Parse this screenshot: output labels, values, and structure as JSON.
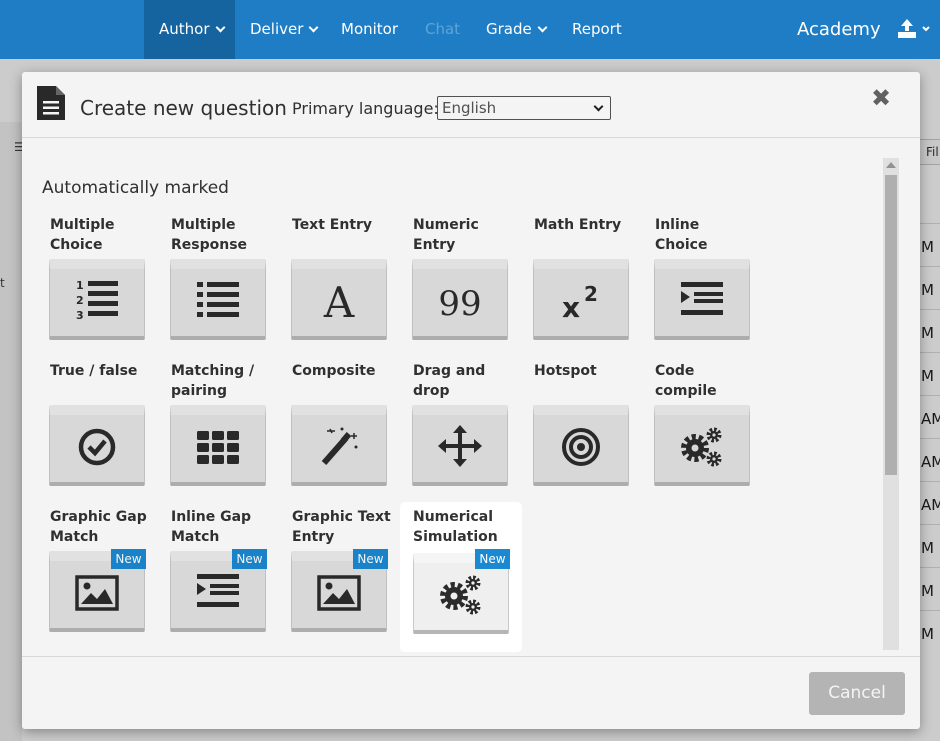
{
  "nav": {
    "items": [
      {
        "label": "Author",
        "dropdown": true,
        "active": true
      },
      {
        "label": "Deliver",
        "dropdown": true
      },
      {
        "label": "Monitor",
        "dropdown": false
      },
      {
        "label": "Chat",
        "dropdown": false,
        "disabled": true
      },
      {
        "label": "Grade",
        "dropdown": true
      },
      {
        "label": "Report",
        "dropdown": false
      }
    ],
    "brand": "Academy",
    "upload_icon": "upload-icon",
    "color": "#1e7dc4"
  },
  "background": {
    "filter_label": "Fil",
    "gutter_label": "☰",
    "arrow_label": "t",
    "times": [
      "M",
      "M",
      "M",
      "M",
      "AM",
      "AM",
      "AM",
      "M",
      "M",
      "M"
    ]
  },
  "modal": {
    "title": "Create new question",
    "primary_language_label": "Primary language:",
    "language": "English",
    "close": "✖",
    "section_title": "Automatically marked",
    "cancel": "Cancel",
    "question_types": [
      {
        "label": "Multiple Choice",
        "icon": "numbered-list-icon"
      },
      {
        "label": "Multiple Response",
        "icon": "bullet-list-icon"
      },
      {
        "label": "Text Entry",
        "icon": "letter-a-icon"
      },
      {
        "label": "Numeric Entry",
        "icon": "number-99-icon"
      },
      {
        "label": "Math Entry",
        "icon": "superscript-icon"
      },
      {
        "label": "Inline Choice",
        "icon": "indent-icon"
      },
      {
        "label": "True / false",
        "icon": "check-circle-icon"
      },
      {
        "label": "Matching / pairing",
        "icon": "grid-icon"
      },
      {
        "label": "Composite",
        "icon": "magic-wand-icon"
      },
      {
        "label": "Drag and drop",
        "icon": "move-arrows-icon"
      },
      {
        "label": "Hotspot",
        "icon": "target-icon"
      },
      {
        "label": "Code compile",
        "icon": "gears-icon"
      },
      {
        "label": "Graphic Gap Match",
        "icon": "image-icon",
        "badge": "New"
      },
      {
        "label": "Inline Gap Match",
        "icon": "indent-icon",
        "badge": "New"
      },
      {
        "label": "Graphic Text Entry",
        "icon": "image-icon",
        "badge": "New"
      },
      {
        "label": "Numerical Simulation",
        "icon": "gears-icon",
        "badge": "New",
        "highlighted": true
      }
    ]
  }
}
